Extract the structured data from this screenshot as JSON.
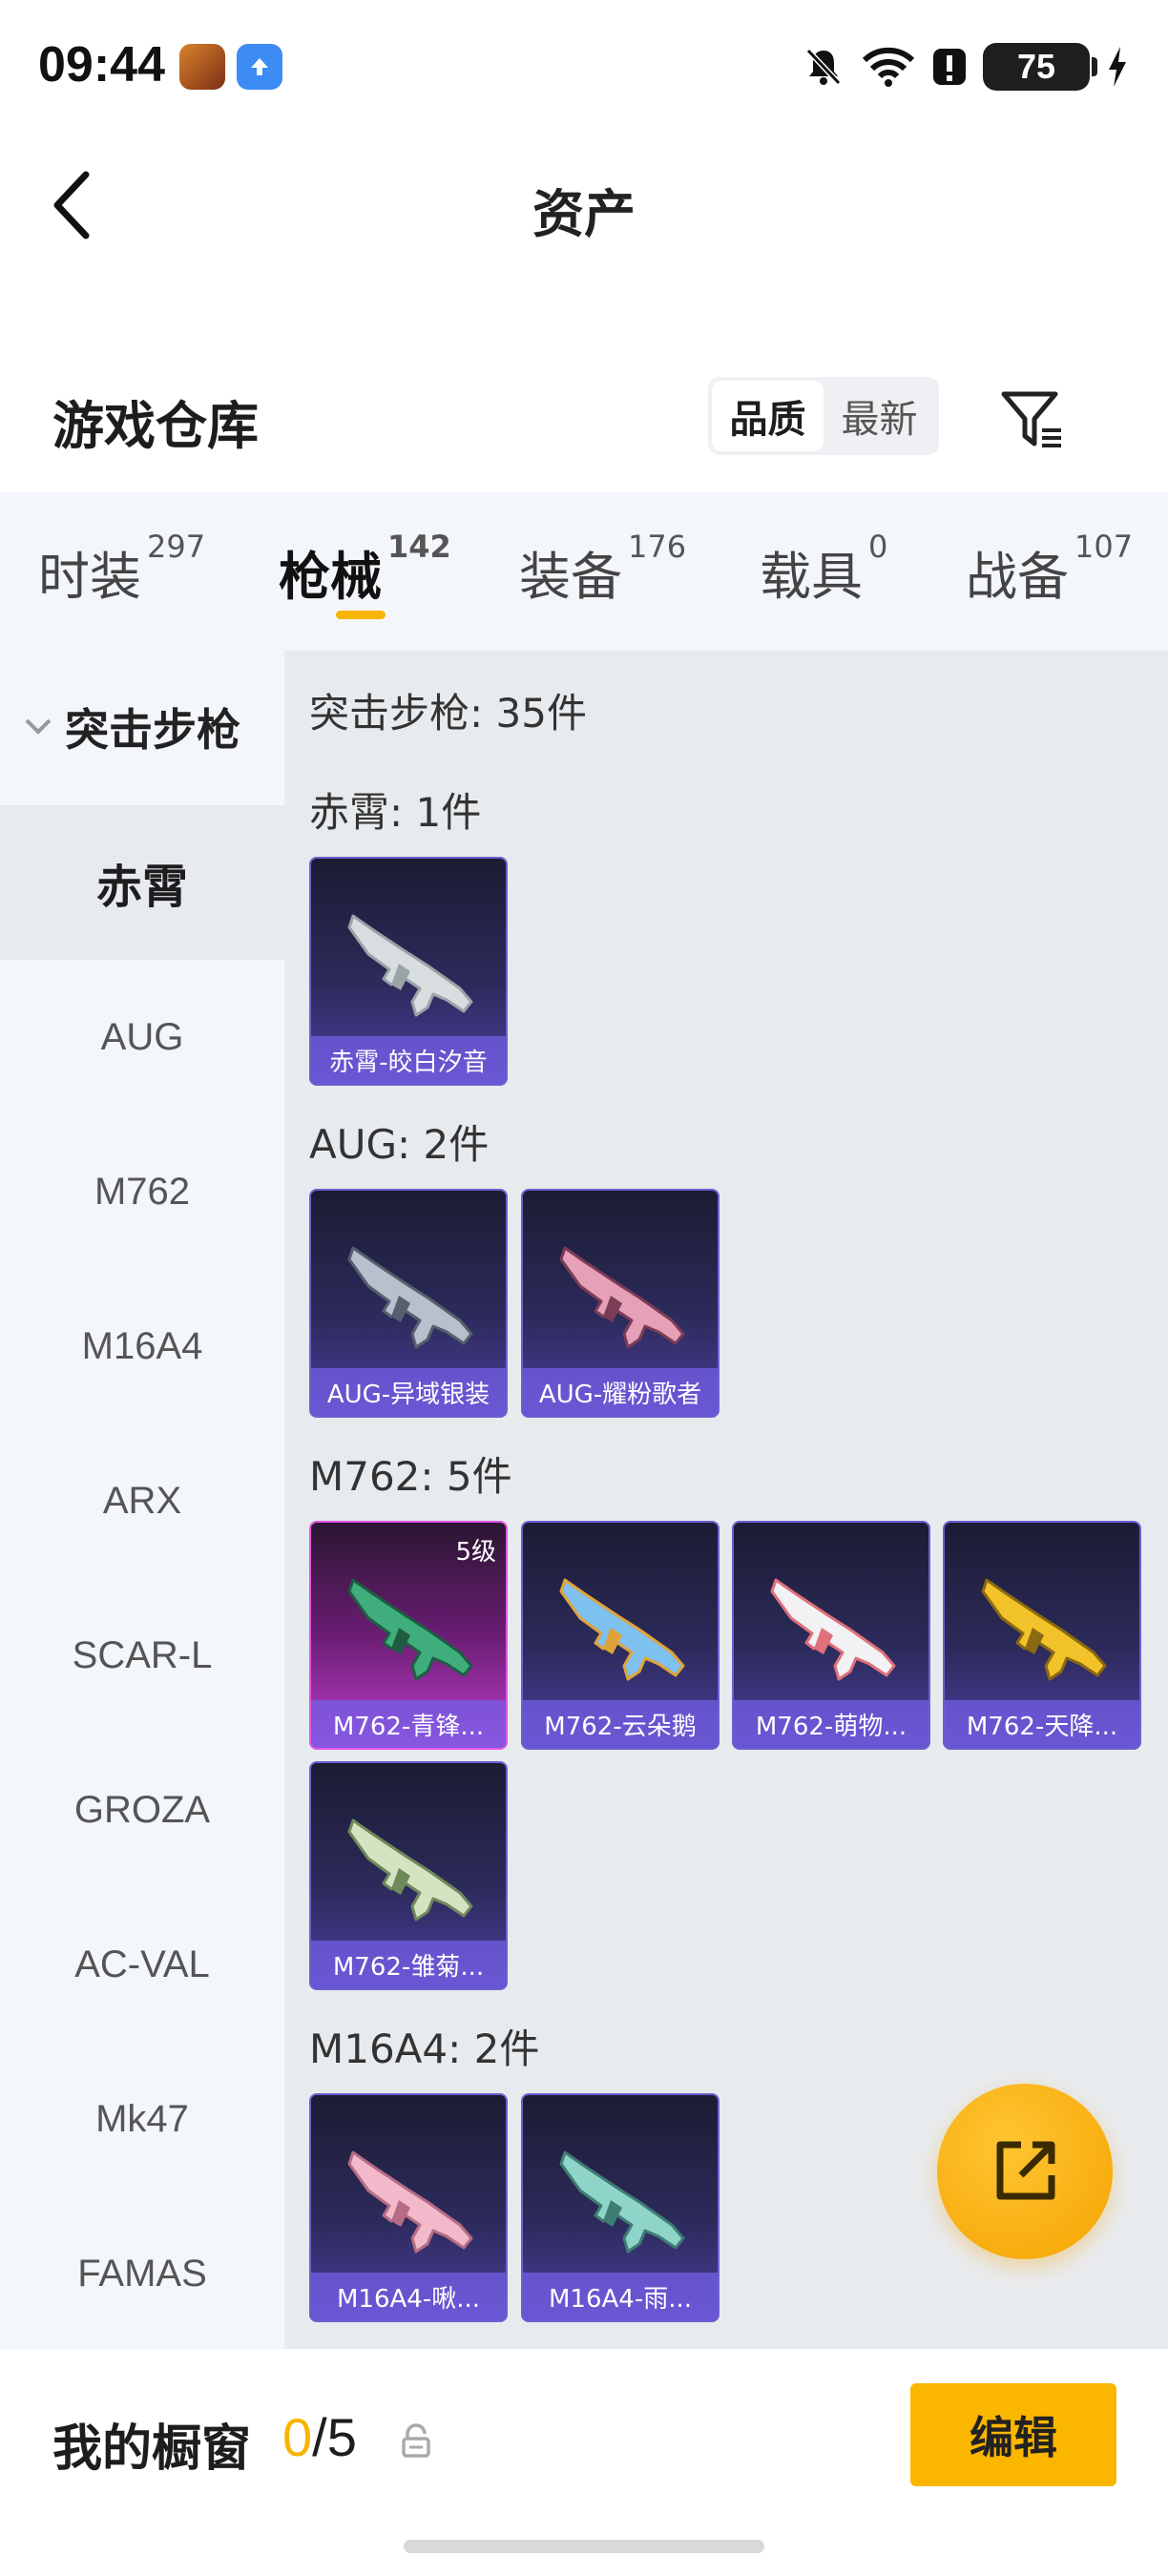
{
  "status_bar": {
    "time": "09:44",
    "battery": "75"
  },
  "header": {
    "title": "资产"
  },
  "warehouse": {
    "title": "游戏仓库",
    "sort_options": [
      "品质",
      "最新"
    ],
    "sort_active": "品质"
  },
  "tabs": [
    {
      "label": "时装",
      "count": "297"
    },
    {
      "label": "枪械",
      "count": "142",
      "active": true
    },
    {
      "label": "装备",
      "count": "176"
    },
    {
      "label": "载具",
      "count": "0"
    },
    {
      "label": "战备",
      "count": "107"
    }
  ],
  "sidebar": {
    "category": "突击步枪",
    "items": [
      "赤霄",
      "AUG",
      "M762",
      "M16A4",
      "ARX",
      "SCAR-L",
      "GROZA",
      "AC-VAL",
      "Mk47",
      "FAMAS"
    ],
    "active_item": "赤霄"
  },
  "content": {
    "total": "突击步枪: 35件",
    "groups": [
      {
        "label": "赤霄: 1件",
        "items": [
          {
            "name": "赤霄-皎白汐音",
            "gun": "#d8dde0",
            "accent": "#9aa3a8"
          }
        ]
      },
      {
        "label": "AUG: 2件",
        "items": [
          {
            "name": "AUG-异域银装",
            "gun": "#b7c0cc",
            "accent": "#55606e"
          },
          {
            "name": "AUG-耀粉歌者",
            "gun": "#e6a0b8",
            "accent": "#7a3d55"
          }
        ]
      },
      {
        "label": "M762: 5件",
        "items": [
          {
            "name": "M762-青锋...",
            "gun": "#3fae7c",
            "accent": "#1f5d43",
            "level": "5级",
            "quality": "legendary"
          },
          {
            "name": "M762-云朵鹅",
            "gun": "#7ec0ee",
            "accent": "#e0a33a"
          },
          {
            "name": "M762-萌物...",
            "gun": "#f2f2f5",
            "accent": "#e0707a"
          },
          {
            "name": "M762-天降...",
            "gun": "#f2c22a",
            "accent": "#8a6a10"
          },
          {
            "name": "M762-雏菊...",
            "gun": "#d6e3c2",
            "accent": "#6f8a5a"
          }
        ]
      },
      {
        "label": "M16A4: 2件",
        "items": [
          {
            "name": "M16A4-啾...",
            "gun": "#f1b9c9",
            "accent": "#b56c84"
          },
          {
            "name": "M16A4-雨...",
            "gun": "#8fd4c8",
            "accent": "#3f7d74"
          }
        ]
      }
    ]
  },
  "showcase": {
    "title": "我的橱窗",
    "current": "0",
    "max": "/5",
    "edit_label": "编辑"
  },
  "colors": {
    "accent": "#f7b500",
    "card_border": "#6c5fd0",
    "legendary_border": "#e255e8"
  }
}
